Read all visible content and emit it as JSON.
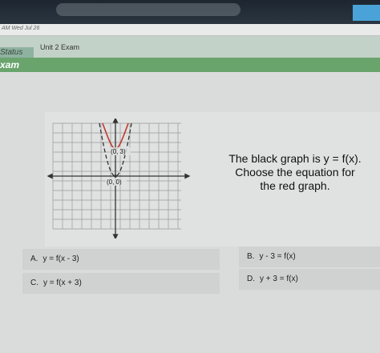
{
  "header": {
    "timestamp": "AM Wed Jul 26",
    "unit_title": "Unit 2 Exam",
    "status_label": "Status",
    "exam_tab": "xam"
  },
  "graph": {
    "point_top": "(0, 3)",
    "point_origin": "(0, 0)",
    "black_curve_color": "#333333",
    "red_curve_color": "#c0392b"
  },
  "question": {
    "line1": "The black graph is y = f(x).",
    "line2": "Choose the equation for",
    "line3": "the red graph."
  },
  "choices": [
    {
      "letter": "A.",
      "text": "y = f(x - 3)"
    },
    {
      "letter": "B.",
      "text": "y - 3 = f(x)"
    },
    {
      "letter": "C.",
      "text": "y = f(x + 3)"
    },
    {
      "letter": "D.",
      "text": "y + 3 = f(x)"
    }
  ]
}
